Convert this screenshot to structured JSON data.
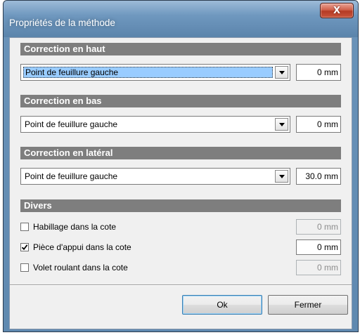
{
  "window": {
    "title": "Propriétés de la méthode",
    "close_glyph": "X"
  },
  "sections": [
    {
      "header": "Correction en haut",
      "combo_value": "Point de feuillure gauche",
      "mm_value": "0 mm"
    },
    {
      "header": "Correction en bas",
      "combo_value": "Point de feuillure gauche",
      "mm_value": "0 mm"
    },
    {
      "header": "Correction en latéral",
      "combo_value": "Point de feuillure gauche",
      "mm_value": "30.0 mm"
    }
  ],
  "divers": {
    "header": "Divers",
    "items": [
      {
        "label": "Habillage dans la cote",
        "checked": false,
        "mm_value": "0 mm",
        "enabled": false
      },
      {
        "label": "Pièce d'appui dans la cote",
        "checked": true,
        "mm_value": "0 mm",
        "enabled": true
      },
      {
        "label": "Volet roulant dans la cote",
        "checked": false,
        "mm_value": "0 mm",
        "enabled": false
      }
    ]
  },
  "buttons": {
    "ok": "Ok",
    "close": "Fermer"
  },
  "colors": {
    "section_header_bg": "#7e7e7e",
    "combo_focus": "#99ccff",
    "close_button": "#c9563d"
  }
}
